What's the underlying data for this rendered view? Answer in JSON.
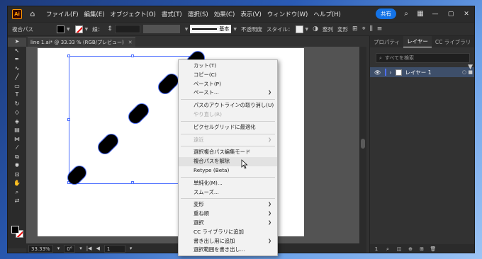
{
  "menubar": {
    "logo": "Ai",
    "menus": [
      "ファイル(F)",
      "編集(E)",
      "オブジェクト(O)",
      "書式(T)",
      "選択(S)",
      "効果(C)",
      "表示(V)",
      "ウィンドウ(W)",
      "ヘルプ(H)"
    ],
    "share_label": "共有"
  },
  "controlbar": {
    "object_type": "複合パス",
    "stroke_label": "線：",
    "line_style_label": "基本",
    "opacity_label": "不透明度",
    "style_label": "スタイル：",
    "align_label": "整列",
    "transform_label": "変形"
  },
  "document": {
    "tab_title": "line 1.ai* @ 33.33 % (RGB/プレビュー)"
  },
  "statusbar": {
    "zoom": "33.33%",
    "rotation": "0°",
    "artboard": "1"
  },
  "panel": {
    "tabs": [
      "プロパティ",
      "レイヤー",
      "CC ライブラリ"
    ],
    "active_tab": "レイヤー",
    "search_placeholder": "すべてを検索",
    "layers": [
      {
        "name": "レイヤー 1"
      }
    ]
  },
  "context_menu": {
    "groups": [
      [
        {
          "label": "カット(T)",
          "disabled": false,
          "submenu": false
        },
        {
          "label": "コピー(C)",
          "disabled": false,
          "submenu": false
        },
        {
          "label": "ペースト(P)",
          "disabled": false,
          "submenu": false
        },
        {
          "label": "ペースト...",
          "disabled": false,
          "submenu": true
        }
      ],
      [
        {
          "label": "パスのアウトラインの取り消し(U)",
          "disabled": false,
          "submenu": false
        },
        {
          "label": "やり直し(R)",
          "disabled": true,
          "submenu": false
        }
      ],
      [
        {
          "label": "ピクセルグリッドに最適化",
          "disabled": false,
          "submenu": false
        }
      ],
      [
        {
          "label": "遠近",
          "disabled": true,
          "submenu": true
        }
      ],
      [
        {
          "label": "選択複合パス編集モード",
          "disabled": false,
          "submenu": false
        },
        {
          "label": "複合パスを解除",
          "disabled": false,
          "submenu": false,
          "hovered": true
        },
        {
          "label": "Retype (Beta)",
          "disabled": false,
          "submenu": false
        }
      ],
      [
        {
          "label": "単純化(M)...",
          "disabled": false,
          "submenu": false
        },
        {
          "label": "スムーズ...",
          "disabled": false,
          "submenu": false
        }
      ],
      [
        {
          "label": "変形",
          "disabled": false,
          "submenu": true
        },
        {
          "label": "重ね順",
          "disabled": false,
          "submenu": true
        },
        {
          "label": "選択",
          "disabled": false,
          "submenu": true
        },
        {
          "label": "CC ライブラリに追加",
          "disabled": false,
          "submenu": false
        },
        {
          "label": "書き出し用に追加",
          "disabled": false,
          "submenu": true
        },
        {
          "label": "選択範囲を書き出し...",
          "disabled": false,
          "submenu": false
        }
      ]
    ]
  },
  "colors": {
    "accent": "#1473e6",
    "selection": "#4d6fff",
    "highlight_row": "#3e4f6a"
  }
}
